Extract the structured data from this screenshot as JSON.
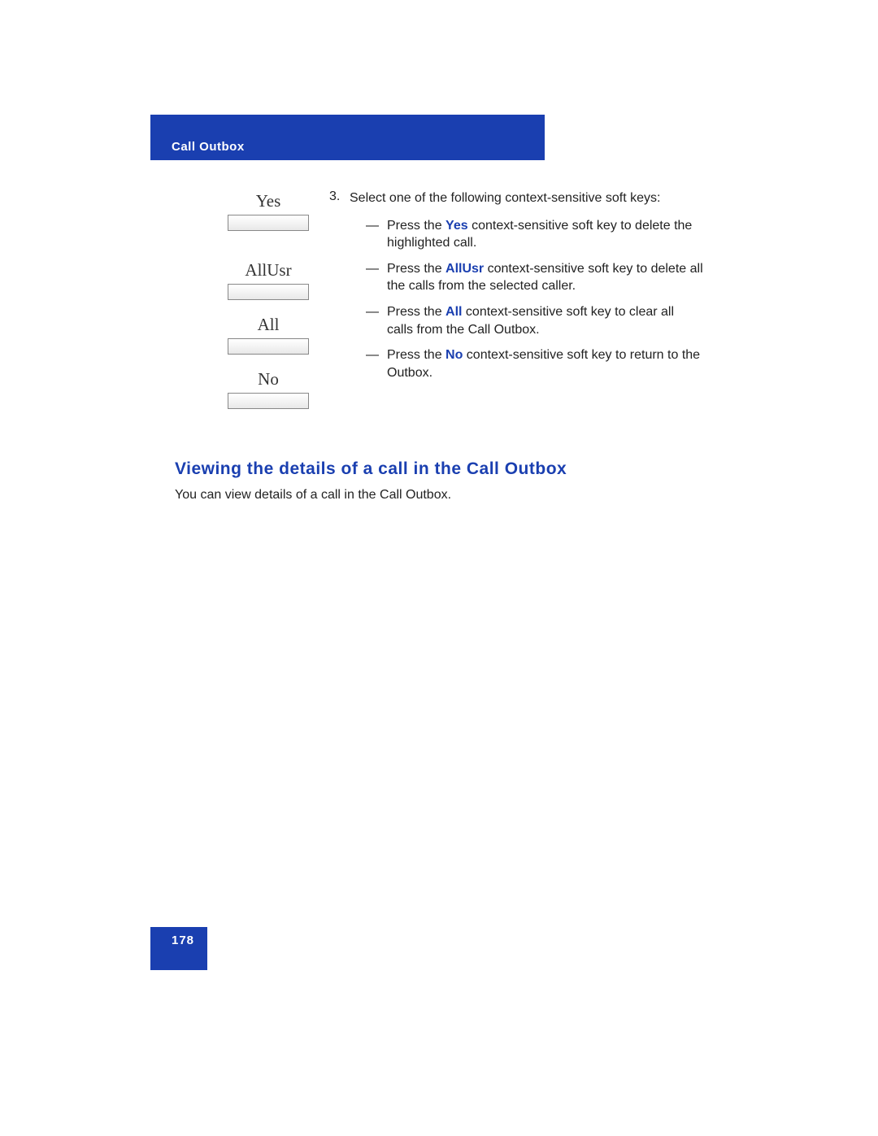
{
  "header": {
    "title": "Call Outbox"
  },
  "softkeys": [
    {
      "label": "Yes"
    },
    {
      "label": "AllUsr"
    },
    {
      "label": "All"
    },
    {
      "label": "No"
    }
  ],
  "step": {
    "number": "3.",
    "intro": "Select one of the following context-sensitive soft keys:",
    "bullets": [
      {
        "prefix": "Press the ",
        "bold": "Yes",
        "suffix": " context-sensitive soft key to delete the highlighted call."
      },
      {
        "prefix": "Press the ",
        "bold": "AllUsr",
        "suffix": " context-sensitive soft key to delete all the calls from the selected caller."
      },
      {
        "prefix": "Press the ",
        "bold": "All",
        "suffix": " context-sensitive soft key to clear all calls from the Call Outbox."
      },
      {
        "prefix": "Press the ",
        "bold": "No",
        "suffix": " context-sensitive soft key to return to the Outbox."
      }
    ]
  },
  "section": {
    "heading": "Viewing the details of a call in the Call Outbox",
    "body": "You can view details of a call in the Call Outbox."
  },
  "footer": {
    "pageNumber": "178"
  }
}
